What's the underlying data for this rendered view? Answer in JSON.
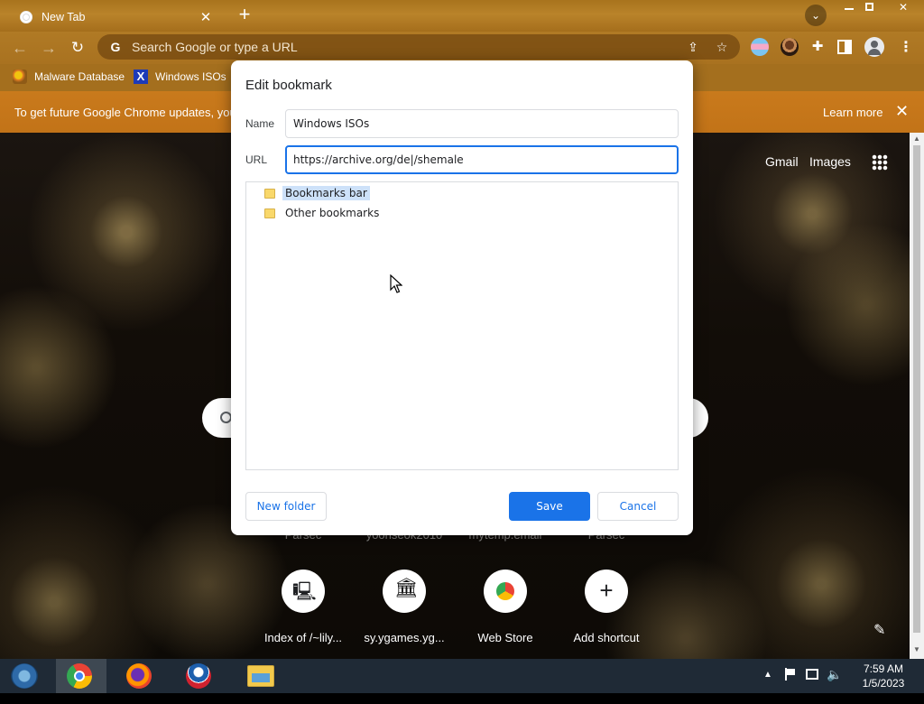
{
  "browser": {
    "tab": {
      "title": "New Tab"
    },
    "omnibox": {
      "placeholder": "Search Google or type a URL"
    },
    "bookmarks": [
      {
        "label": "Malware Database"
      },
      {
        "label": "Windows ISOs"
      }
    ],
    "infobar": {
      "text": "To get future Google Chrome updates, you'",
      "learn_more": "Learn more"
    }
  },
  "ntp": {
    "links": {
      "gmail": "Gmail",
      "images": "Images"
    },
    "faded_labels": [
      "Parsec",
      "yoonseok2010",
      "mytemp.email",
      "Parsec"
    ],
    "shortcuts": [
      {
        "label": "Index of /~lily...",
        "icon": "computer-icon"
      },
      {
        "label": "sy.ygames.yg...",
        "icon": "archive-building-icon"
      },
      {
        "label": "Web Store",
        "icon": "web-store-icon"
      },
      {
        "label": "Add shortcut",
        "icon": "plus-icon"
      }
    ]
  },
  "dialog": {
    "title": "Edit bookmark",
    "name_label": "Name",
    "name_value": "Windows ISOs",
    "url_label": "URL",
    "url_value": "https://archive.org/de|/shemale",
    "folders": [
      {
        "label": "Bookmarks bar",
        "selected": true
      },
      {
        "label": "Other bookmarks",
        "selected": false
      }
    ],
    "new_folder_label": "New folder",
    "save_label": "Save",
    "cancel_label": "Cancel"
  },
  "taskbar": {
    "apps": [
      "start-icon",
      "chrome-icon",
      "firefox-icon",
      "obama-campaign-icon",
      "file-explorer-icon"
    ],
    "clock": {
      "time": "7:59 AM",
      "date": "1/5/2023"
    }
  },
  "colors": {
    "accent": "#1a73e8",
    "theme_orange": "#c27318",
    "selection": "#cde1f9"
  }
}
